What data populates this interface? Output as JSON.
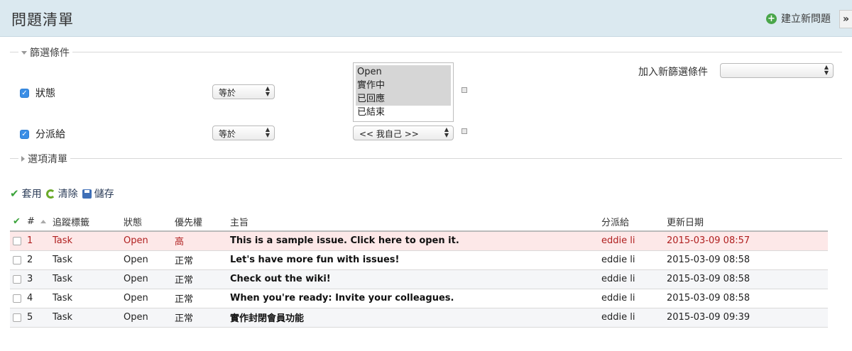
{
  "header": {
    "title": "問題清單",
    "new_issue_label": "建立新問題",
    "collapse_label": "»"
  },
  "filters": {
    "legend": "篩選條件",
    "add_filter_label": "加入新篩選條件",
    "add_filter_value": "",
    "status": {
      "label": "狀態",
      "operator": "等於",
      "options": [
        {
          "label": "Open",
          "selected": true
        },
        {
          "label": "實作中",
          "selected": true
        },
        {
          "label": "已回應",
          "selected": true
        },
        {
          "label": "已結束",
          "selected": false
        }
      ]
    },
    "assignee": {
      "label": "分派給",
      "operator": "等於",
      "value": "<< 我自己 >>"
    }
  },
  "options": {
    "legend": "選項清單"
  },
  "actions": {
    "apply": "套用",
    "clear": "清除",
    "save": "儲存"
  },
  "table": {
    "headers": [
      "#",
      "追蹤標籤",
      "狀態",
      "優先權",
      "主旨",
      "分派給",
      "更新日期"
    ],
    "rows": [
      {
        "id": "1",
        "tracker": "Task",
        "status": "Open",
        "priority": "高",
        "subject": "This is a sample issue. Click here to open it.",
        "assignee": "eddie li",
        "updated": "2015-03-09 08:57"
      },
      {
        "id": "2",
        "tracker": "Task",
        "status": "Open",
        "priority": "正常",
        "subject": "Let's have more fun with issues!",
        "assignee": "eddie li",
        "updated": "2015-03-09 08:58"
      },
      {
        "id": "3",
        "tracker": "Task",
        "status": "Open",
        "priority": "正常",
        "subject": "Check out the wiki!",
        "assignee": "eddie li",
        "updated": "2015-03-09 08:58"
      },
      {
        "id": "4",
        "tracker": "Task",
        "status": "Open",
        "priority": "正常",
        "subject": "When you're ready: Invite your colleagues.",
        "assignee": "eddie li",
        "updated": "2015-03-09 08:58"
      },
      {
        "id": "5",
        "tracker": "Task",
        "status": "Open",
        "priority": "正常",
        "subject": "實作封閉會員功能",
        "assignee": "eddie li",
        "updated": "2015-03-09 09:39"
      }
    ]
  },
  "colors": {
    "header_bg": "#dbe9f0",
    "highlight_row": "#fde8e8",
    "highlight_text": "#b02020",
    "accent_green": "#3aa33a"
  }
}
